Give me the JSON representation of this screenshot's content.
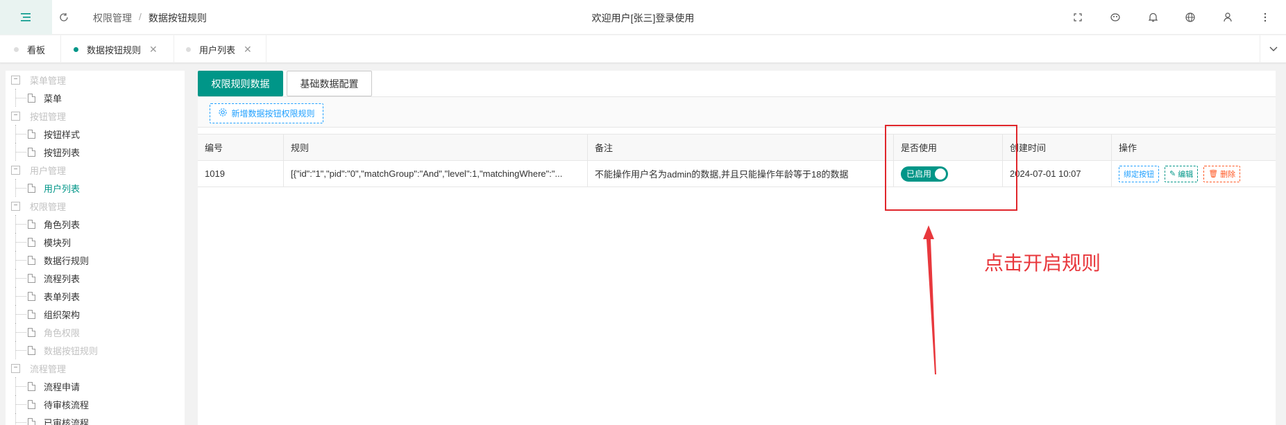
{
  "header": {
    "breadcrumb": [
      "权限管理",
      "数据按钮规则"
    ],
    "breadcrumb_sep": "/",
    "welcome": "欢迎用户[张三]登录使用",
    "icons": [
      "fullscreen-icon",
      "theme-icon",
      "bell-icon",
      "globe-icon",
      "user-icon",
      "more-vertical-icon"
    ]
  },
  "tabs": [
    {
      "label": "看板",
      "active": false,
      "closable": false
    },
    {
      "label": "数据按钮规则",
      "active": true,
      "closable": true,
      "close": "✕"
    },
    {
      "label": "用户列表",
      "active": false,
      "closable": true,
      "close": "✕"
    }
  ],
  "sidebar": {
    "groups": [
      {
        "label": "菜单管理",
        "box": "−",
        "items": [
          {
            "label": "菜单"
          }
        ]
      },
      {
        "label": "按钮管理",
        "box": "−",
        "items": [
          {
            "label": "按钮样式"
          },
          {
            "label": "按钮列表"
          }
        ]
      },
      {
        "label": "用户管理",
        "box": "−",
        "items": [
          {
            "label": "用户列表"
          }
        ]
      },
      {
        "label": "权限管理",
        "box": "−",
        "items": [
          {
            "label": "角色列表"
          },
          {
            "label": "模块列"
          },
          {
            "label": "数据行规则"
          },
          {
            "label": "流程列表"
          },
          {
            "label": "表单列表"
          },
          {
            "label": "组织架构"
          },
          {
            "label": "角色权限"
          },
          {
            "label": "数据按钮规则"
          }
        ]
      },
      {
        "label": "流程管理",
        "box": "−",
        "items": [
          {
            "label": "流程申请"
          },
          {
            "label": "待审核流程"
          },
          {
            "label": "已审核流程"
          }
        ]
      }
    ]
  },
  "main": {
    "tab_primary": "权限规则数据",
    "tab_secondary": "基础数据配置",
    "add_button": "新增数据按钮权限规则",
    "columns": [
      "编号",
      "规则",
      "备注",
      "是否使用",
      "创建时间",
      "操作"
    ],
    "rows": [
      {
        "id": "1019",
        "rule": "[{\"id\":\"1\",\"pid\":\"0\",\"matchGroup\":\"And\",\"level\":1,\"matchingWhere\":\"...",
        "remark": "不能操作用户名为admin的数据,并且只能操作年龄等于18的数据",
        "enabled_label": "已启用",
        "enabled": true,
        "created": "2024-07-01 10:07",
        "actions": {
          "bind": "绑定按钮",
          "edit": "编辑",
          "delete": "删除"
        }
      }
    ]
  },
  "annotation": {
    "text": "点击开启规则",
    "color": "#e8383d"
  },
  "colors": {
    "primary": "#009688",
    "blue": "#1e9fff",
    "danger": "#ff5722"
  }
}
